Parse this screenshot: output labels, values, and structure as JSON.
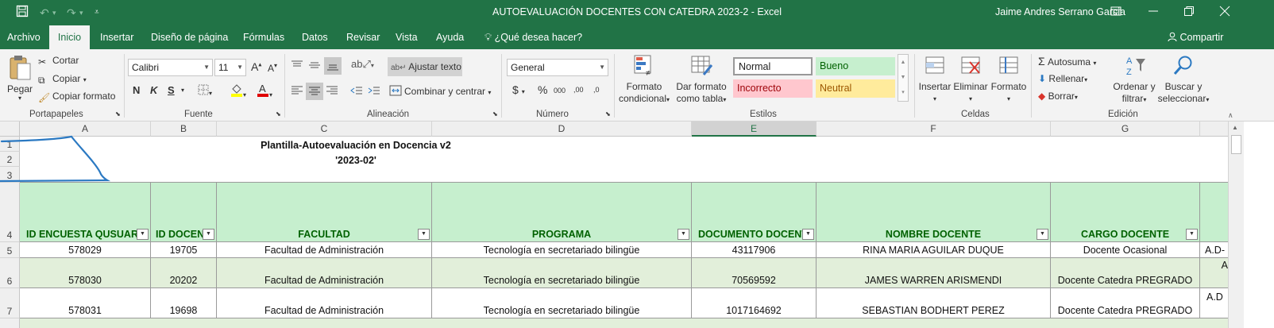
{
  "window": {
    "title": "AUTOEVALUACIÓN DOCENTES CON CATEDRA 2023-2  -  Excel",
    "user": "Jaime Andres  Serrano Garcia",
    "share_label": "Compartir"
  },
  "icons": {
    "save": "save-icon",
    "undo": "undo-icon",
    "redo": "redo-icon",
    "customize": "customize-qat-icon",
    "ribbon_display": "ribbon-display-options-icon",
    "minimize": "minimize-icon",
    "restore": "restore-icon",
    "close": "close-icon",
    "lightbulb": "lightbulb-icon",
    "person": "person-icon"
  },
  "colors": {
    "brand": "#217346",
    "header_fill": "#c6efce",
    "header_text": "#006100",
    "band_fill": "#e2efda"
  },
  "menu": {
    "tabs": [
      {
        "label": "Archivo"
      },
      {
        "label": "Inicio"
      },
      {
        "label": "Insertar"
      },
      {
        "label": "Diseño de página"
      },
      {
        "label": "Fórmulas"
      },
      {
        "label": "Datos"
      },
      {
        "label": "Revisar"
      },
      {
        "label": "Vista"
      },
      {
        "label": "Ayuda"
      }
    ],
    "tell_me": "¿Qué desea hacer?"
  },
  "ribbon": {
    "clipboard": {
      "paste": "Pegar",
      "cut": "Cortar",
      "copy": "Copiar",
      "format_painter": "Copiar formato",
      "group": "Portapapeles"
    },
    "font": {
      "name": "Calibri",
      "size": "11",
      "bold": "N",
      "italic": "K",
      "underline": "S",
      "group": "Fuente"
    },
    "alignment": {
      "wrap": "Ajustar texto",
      "merge": "Combinar y centrar",
      "group": "Alineación"
    },
    "number": {
      "format": "General",
      "currency": "$",
      "percent": "%",
      "thousands": "000",
      "inc_dec": ",00",
      "dec_dec": ",0",
      "group": "Número"
    },
    "styles": {
      "conditional_l1": "Formato",
      "conditional_l2": "condicional",
      "table_l1": "Dar formato",
      "table_l2": "como tabla",
      "normal": "Normal",
      "good": "Bueno",
      "bad": "Incorrecto",
      "neutral": "Neutral",
      "group": "Estilos"
    },
    "cells": {
      "insert": "Insertar",
      "delete": "Eliminar",
      "format": "Formato",
      "group": "Celdas"
    },
    "editing": {
      "autosum": "Autosuma",
      "fill": "Rellenar",
      "clear": "Borrar",
      "sort_l1": "Ordenar y",
      "sort_l2": "filtrar",
      "find_l1": "Buscar y",
      "find_l2": "seleccionar",
      "group": "Edición"
    }
  },
  "sheet": {
    "columns": [
      "A",
      "B",
      "C",
      "D",
      "E",
      "F",
      "G"
    ],
    "rows": [
      "1",
      "2",
      "3",
      "4",
      "5",
      "6",
      "7"
    ],
    "title": "Plantilla-Autoevaluación en Docencia v2",
    "period": "'2023-02'",
    "headers": [
      "ID ENCUESTA QUSUARI",
      "ID DOCENT",
      "FACULTAD",
      "PROGRAMA",
      "DOCUMENTO DOCENT",
      "NOMBRE DOCENTE",
      "CARGO DOCENTE"
    ],
    "data_rows": [
      {
        "id": "578029",
        "doc_id": "19705",
        "faculty": "Facultad de Administración",
        "program": "Tecnología en secretariado bilingüe",
        "document": "43117906",
        "name": "RINA MARIA AGUILAR DUQUE",
        "role": "Docente Ocasional",
        "next": "A.D-"
      },
      {
        "id": "578030",
        "doc_id": "20202",
        "faculty": "Facultad de Administración",
        "program": "Tecnología en secretariado bilingüe",
        "document": "70569592",
        "name": "JAMES WARREN ARISMENDI",
        "role": "Docente Catedra PREGRADO",
        "next": "A"
      },
      {
        "id": "578031",
        "doc_id": "19698",
        "faculty": "Facultad de Administración",
        "program": "Tecnología en secretariado bilingüe",
        "document": "1017164692",
        "name": "SEBASTIAN BODHERT PEREZ",
        "role": "Docente Catedra PREGRADO",
        "next": "A.D"
      }
    ]
  }
}
